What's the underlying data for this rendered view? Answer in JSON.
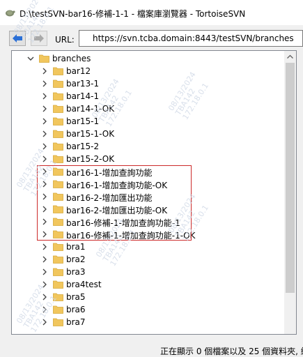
{
  "window": {
    "title": "D:\\testSVN-bar16-修補-1-1 - 檔案庫瀏覽器 - TortoiseSVN"
  },
  "toolbar": {
    "url_label": "URL:",
    "url_value": "https://svn.tcba.domain:8443/testSVN/branches"
  },
  "tree": {
    "root": "branches",
    "items": [
      "bar12",
      "bar13-1",
      "bar14-1",
      "bar14-1-OK",
      "bar15-1",
      "bar15-1-OK",
      "bar15-2",
      "bar15-2-OK",
      "bar16-1-增加查詢功能",
      "bar16-1-增加查詢功能-OK",
      "bar16-2-增加匯出功能",
      "bar16-2-增加匯出功能-OK",
      "bar16-修補-1-增加查詢功能-1",
      "bar16-修補-1-增加查詢功能-1-OK",
      "bra1",
      "bra2",
      "bra3",
      "bra4test",
      "bra5",
      "bra6",
      "bra7"
    ]
  },
  "status": {
    "text": "正在顯示 0 個檔案以及 25 個資料夾, 總"
  },
  "watermark": {
    "date": "08/13/2024",
    "user": "TBA142",
    "ip": "172.18.0.1"
  },
  "colors": {
    "highlight_border": "#cc2a2a",
    "folder": "#f1c65d"
  }
}
